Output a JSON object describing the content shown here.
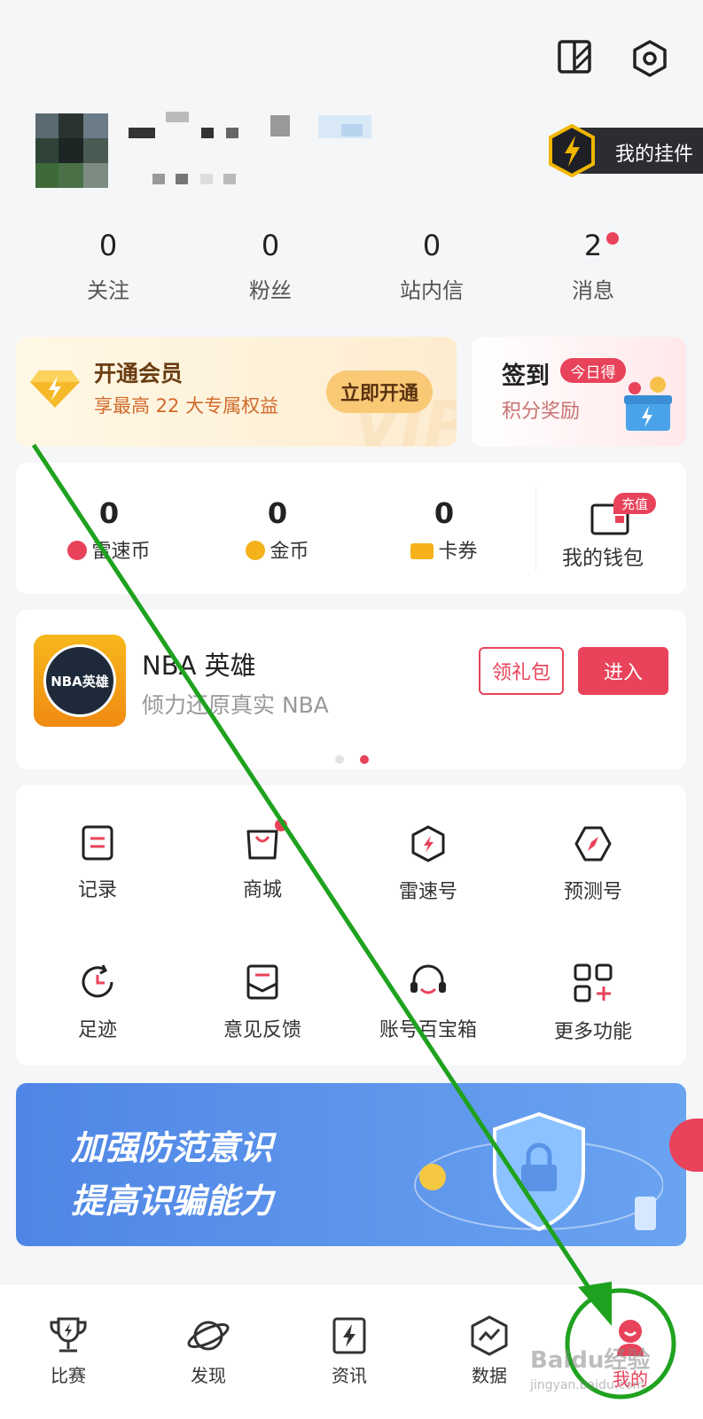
{
  "header": {
    "widget_label": "我的挂件"
  },
  "stats": [
    {
      "value": "0",
      "label": "关注"
    },
    {
      "value": "0",
      "label": "粉丝"
    },
    {
      "value": "0",
      "label": "站内信"
    },
    {
      "value": "2",
      "label": "消息"
    }
  ],
  "vip": {
    "title": "开通会员",
    "subtitle": "享最高 22 大专属权益",
    "button": "立即开通",
    "watermark": "VIP"
  },
  "checkin": {
    "title": "签到",
    "badge": "今日得",
    "subtitle": "积分奖励"
  },
  "wallet": {
    "items": [
      {
        "value": "0",
        "label": "雷速币"
      },
      {
        "value": "0",
        "label": "金币"
      },
      {
        "value": "0",
        "label": "卡券"
      }
    ],
    "recharge_badge": "充值",
    "wallet_label": "我的钱包"
  },
  "game": {
    "logo_text": "NBA英雄",
    "title": "NBA 英雄",
    "subtitle": "倾力还原真实 NBA",
    "gift_button": "领礼包",
    "enter_button": "进入"
  },
  "functions": [
    {
      "label": "记录",
      "icon": "record-icon"
    },
    {
      "label": "商城",
      "icon": "shop-icon"
    },
    {
      "label": "雷速号",
      "icon": "leisu-icon"
    },
    {
      "label": "预测号",
      "icon": "predict-icon"
    },
    {
      "label": "足迹",
      "icon": "history-icon"
    },
    {
      "label": "意见反馈",
      "icon": "feedback-icon"
    },
    {
      "label": "账号百宝箱",
      "icon": "support-icon"
    },
    {
      "label": "更多功能",
      "icon": "more-icon"
    }
  ],
  "banner": {
    "line1": "加强防范意识",
    "line2": "提高识骗能力"
  },
  "tabbar": [
    {
      "label": "比赛",
      "icon": "trophy-icon"
    },
    {
      "label": "发现",
      "icon": "planet-icon"
    },
    {
      "label": "资讯",
      "icon": "news-icon"
    },
    {
      "label": "数据",
      "icon": "data-icon"
    },
    {
      "label": "我的",
      "icon": "profile-icon"
    }
  ],
  "colors": {
    "accent": "#e8435a",
    "gold": "#f5b21a",
    "banner": "#4f86e6",
    "annotation": "#1fa21f"
  },
  "watermark": {
    "brand": "Baidu经验",
    "url": "jingyan.baidu.com"
  }
}
